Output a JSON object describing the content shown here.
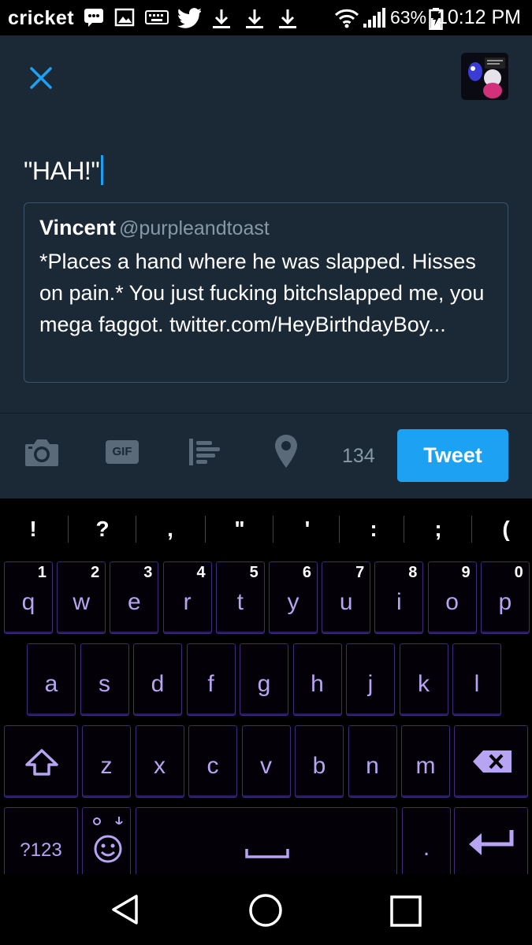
{
  "status_bar": {
    "carrier": "cricket",
    "battery": "63%",
    "time": "10:12 PM"
  },
  "compose": {
    "tweet_text": "\"HAH!\"",
    "quote": {
      "name": "Vincent",
      "handle": "@purpleandtoast",
      "body": "*Places a hand where he was slapped. Hisses on pain.* You just fucking bitchslapped me, you mega faggot. twitter.com/HeyBirthdayBoy..."
    },
    "toolbar": {
      "gif_label": "GIF",
      "char_count": "134",
      "tweet_label": "Tweet"
    },
    "colors": {
      "accent": "#1da1f2",
      "background": "#1b2836"
    }
  },
  "keyboard": {
    "symbols": [
      "!",
      "?",
      ",",
      "\"",
      "'",
      ":",
      ";",
      "("
    ],
    "row1": [
      {
        "k": "q",
        "n": "1"
      },
      {
        "k": "w",
        "n": "2"
      },
      {
        "k": "e",
        "n": "3"
      },
      {
        "k": "r",
        "n": "4"
      },
      {
        "k": "t",
        "n": "5"
      },
      {
        "k": "y",
        "n": "6"
      },
      {
        "k": "u",
        "n": "7"
      },
      {
        "k": "i",
        "n": "8"
      },
      {
        "k": "o",
        "n": "9"
      },
      {
        "k": "p",
        "n": "0"
      }
    ],
    "row2": [
      "a",
      "s",
      "d",
      "f",
      "g",
      "h",
      "j",
      "k",
      "l"
    ],
    "row3": [
      "z",
      "x",
      "c",
      "v",
      "b",
      "n",
      "m"
    ],
    "mode_label": "?123",
    "period": ".",
    "key_color": "#b7a4f2"
  }
}
